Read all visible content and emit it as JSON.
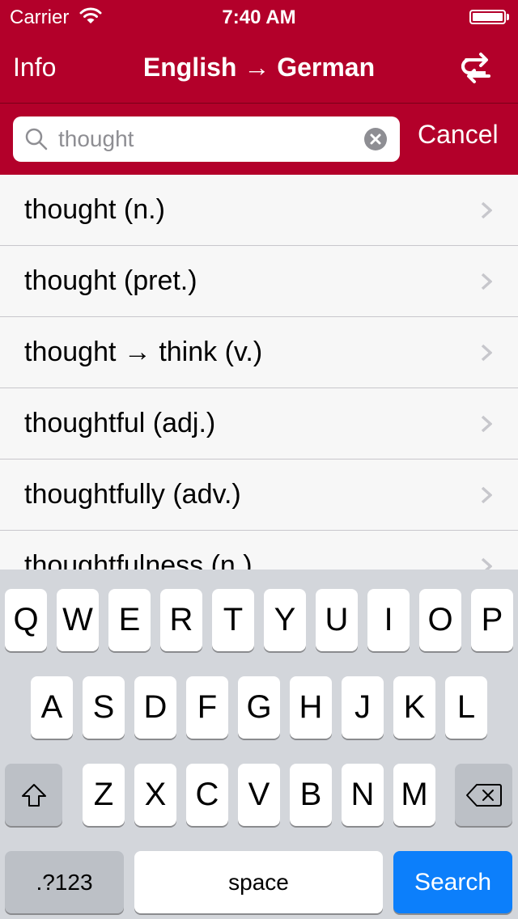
{
  "status_bar": {
    "carrier": "Carrier",
    "time": "7:40 AM",
    "wifi_icon": "wifi-icon",
    "battery_icon": "battery-icon",
    "battery_level": 1.0
  },
  "navbar": {
    "left_button": "Info",
    "title": "English → German",
    "right_icon": "swap-direction-icon"
  },
  "search": {
    "value": "thought",
    "search_icon": "magnifier-icon",
    "clear_icon": "clear-circle-icon",
    "cancel_label": "Cancel"
  },
  "results": [
    {
      "label": "thought (n.)"
    },
    {
      "label": "thought (pret.)"
    },
    {
      "label": "thought → think (v.)"
    },
    {
      "label": "thoughtful (adj.)"
    },
    {
      "label": "thoughtfully (adv.)"
    },
    {
      "label": "thoughtfulness (n.)"
    }
  ],
  "keyboard": {
    "row1": [
      "Q",
      "W",
      "E",
      "R",
      "T",
      "Y",
      "U",
      "I",
      "O",
      "P"
    ],
    "row2": [
      "A",
      "S",
      "D",
      "F",
      "G",
      "H",
      "J",
      "K",
      "L"
    ],
    "row3": [
      "Z",
      "X",
      "C",
      "V",
      "B",
      "N",
      "M"
    ],
    "shift_icon": "shift-icon",
    "delete_icon": "delete-backspace-icon",
    "numbers_label": ".?123",
    "space_label": "space",
    "search_label": "Search"
  },
  "colors": {
    "brand": "#b3002a",
    "keyboard_bg": "#d3d6db",
    "search_key": "#0c7ffb",
    "row_bg": "#f7f7f7",
    "separator": "#c8c7cc"
  }
}
